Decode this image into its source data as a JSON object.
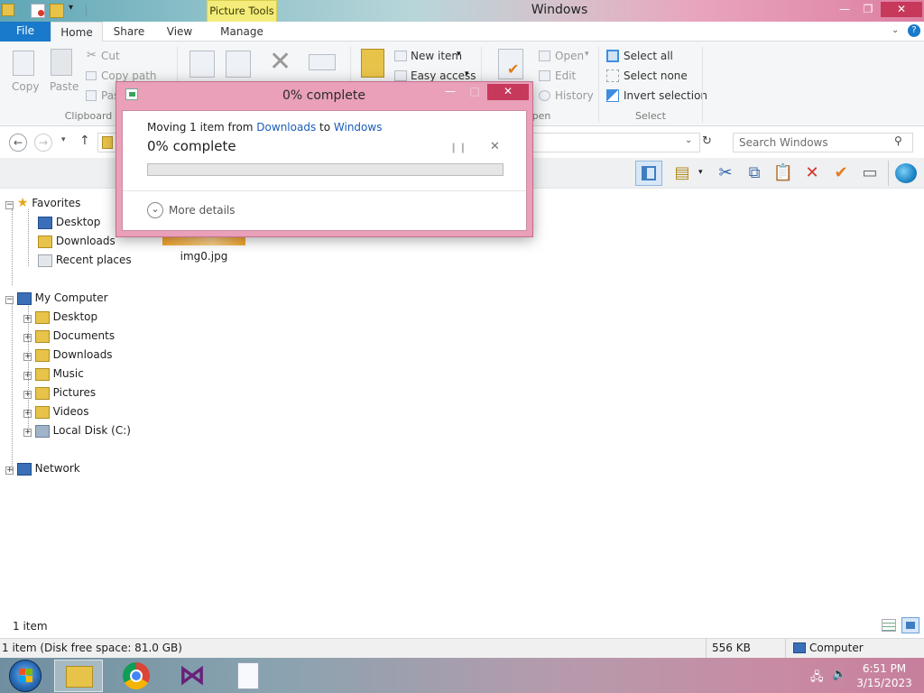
{
  "window": {
    "title": "Windows",
    "contextual_tab": "Picture Tools",
    "controls": {
      "minimize": "—",
      "maximize": "❐",
      "close": "✕"
    }
  },
  "ribbon": {
    "tabs": [
      {
        "label": "File"
      },
      {
        "label": "Home"
      },
      {
        "label": "Share"
      },
      {
        "label": "View"
      },
      {
        "label": "Manage"
      }
    ],
    "clipboard": {
      "copy": "Copy",
      "paste": "Paste",
      "cut": "Cut",
      "copy_path": "Copy path",
      "paste_shortcut": "Pas",
      "group": "Clipboard"
    },
    "new": {
      "new_item": "New item",
      "easy_access": "Easy access"
    },
    "open": {
      "open": "Open",
      "edit": "Edit",
      "history": "History",
      "group": "pen"
    },
    "select": {
      "select_all": "Select all",
      "select_none": "Select none",
      "invert": "Invert selection",
      "group": "Select"
    }
  },
  "address": {
    "search_placeholder": "Search Windows"
  },
  "nav": {
    "favorites": {
      "label": "Favorites",
      "items": [
        {
          "label": "Desktop"
        },
        {
          "label": "Downloads"
        },
        {
          "label": "Recent places"
        }
      ]
    },
    "computer": {
      "label": "My Computer",
      "items": [
        {
          "label": "Desktop"
        },
        {
          "label": "Documents"
        },
        {
          "label": "Downloads"
        },
        {
          "label": "Music"
        },
        {
          "label": "Pictures"
        },
        {
          "label": "Videos"
        },
        {
          "label": "Local Disk (C:)"
        }
      ]
    },
    "network": {
      "label": "Network"
    }
  },
  "content": {
    "files": [
      {
        "name": "img0.jpg"
      }
    ]
  },
  "status": {
    "item_count": "1 item",
    "detail": "1 item (Disk free space: 81.0 GB)",
    "size": "556 KB",
    "location": "Computer"
  },
  "dialog": {
    "title": "0% complete",
    "moving_prefix": "Moving 1 item from ",
    "source": "Downloads",
    "middle": " to ",
    "destination": "Windows",
    "progress_text": "0% complete",
    "progress_fraction": 0,
    "more_details": "More details",
    "controls": {
      "minimize": "—",
      "maximize": "□",
      "close": "✕"
    }
  },
  "taskbar": {
    "time": "6:51 PM",
    "date": "3/15/2023"
  },
  "colors": {
    "accent": "#1979ca",
    "dialog_frame": "#e9a0b8",
    "link": "#1b5eb8",
    "progress_fill": "#06b025"
  }
}
